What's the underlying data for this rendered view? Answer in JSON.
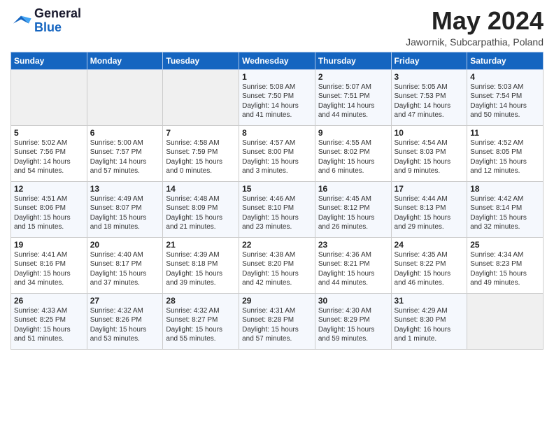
{
  "header": {
    "logo_general": "General",
    "logo_blue": "Blue",
    "month_title": "May 2024",
    "subtitle": "Jawornik, Subcarpathia, Poland"
  },
  "weekdays": [
    "Sunday",
    "Monday",
    "Tuesday",
    "Wednesday",
    "Thursday",
    "Friday",
    "Saturday"
  ],
  "weeks": [
    [
      {
        "day": "",
        "info": ""
      },
      {
        "day": "",
        "info": ""
      },
      {
        "day": "",
        "info": ""
      },
      {
        "day": "1",
        "info": "Sunrise: 5:08 AM\nSunset: 7:50 PM\nDaylight: 14 hours\nand 41 minutes."
      },
      {
        "day": "2",
        "info": "Sunrise: 5:07 AM\nSunset: 7:51 PM\nDaylight: 14 hours\nand 44 minutes."
      },
      {
        "day": "3",
        "info": "Sunrise: 5:05 AM\nSunset: 7:53 PM\nDaylight: 14 hours\nand 47 minutes."
      },
      {
        "day": "4",
        "info": "Sunrise: 5:03 AM\nSunset: 7:54 PM\nDaylight: 14 hours\nand 50 minutes."
      }
    ],
    [
      {
        "day": "5",
        "info": "Sunrise: 5:02 AM\nSunset: 7:56 PM\nDaylight: 14 hours\nand 54 minutes."
      },
      {
        "day": "6",
        "info": "Sunrise: 5:00 AM\nSunset: 7:57 PM\nDaylight: 14 hours\nand 57 minutes."
      },
      {
        "day": "7",
        "info": "Sunrise: 4:58 AM\nSunset: 7:59 PM\nDaylight: 15 hours\nand 0 minutes."
      },
      {
        "day": "8",
        "info": "Sunrise: 4:57 AM\nSunset: 8:00 PM\nDaylight: 15 hours\nand 3 minutes."
      },
      {
        "day": "9",
        "info": "Sunrise: 4:55 AM\nSunset: 8:02 PM\nDaylight: 15 hours\nand 6 minutes."
      },
      {
        "day": "10",
        "info": "Sunrise: 4:54 AM\nSunset: 8:03 PM\nDaylight: 15 hours\nand 9 minutes."
      },
      {
        "day": "11",
        "info": "Sunrise: 4:52 AM\nSunset: 8:05 PM\nDaylight: 15 hours\nand 12 minutes."
      }
    ],
    [
      {
        "day": "12",
        "info": "Sunrise: 4:51 AM\nSunset: 8:06 PM\nDaylight: 15 hours\nand 15 minutes."
      },
      {
        "day": "13",
        "info": "Sunrise: 4:49 AM\nSunset: 8:07 PM\nDaylight: 15 hours\nand 18 minutes."
      },
      {
        "day": "14",
        "info": "Sunrise: 4:48 AM\nSunset: 8:09 PM\nDaylight: 15 hours\nand 21 minutes."
      },
      {
        "day": "15",
        "info": "Sunrise: 4:46 AM\nSunset: 8:10 PM\nDaylight: 15 hours\nand 23 minutes."
      },
      {
        "day": "16",
        "info": "Sunrise: 4:45 AM\nSunset: 8:12 PM\nDaylight: 15 hours\nand 26 minutes."
      },
      {
        "day": "17",
        "info": "Sunrise: 4:44 AM\nSunset: 8:13 PM\nDaylight: 15 hours\nand 29 minutes."
      },
      {
        "day": "18",
        "info": "Sunrise: 4:42 AM\nSunset: 8:14 PM\nDaylight: 15 hours\nand 32 minutes."
      }
    ],
    [
      {
        "day": "19",
        "info": "Sunrise: 4:41 AM\nSunset: 8:16 PM\nDaylight: 15 hours\nand 34 minutes."
      },
      {
        "day": "20",
        "info": "Sunrise: 4:40 AM\nSunset: 8:17 PM\nDaylight: 15 hours\nand 37 minutes."
      },
      {
        "day": "21",
        "info": "Sunrise: 4:39 AM\nSunset: 8:18 PM\nDaylight: 15 hours\nand 39 minutes."
      },
      {
        "day": "22",
        "info": "Sunrise: 4:38 AM\nSunset: 8:20 PM\nDaylight: 15 hours\nand 42 minutes."
      },
      {
        "day": "23",
        "info": "Sunrise: 4:36 AM\nSunset: 8:21 PM\nDaylight: 15 hours\nand 44 minutes."
      },
      {
        "day": "24",
        "info": "Sunrise: 4:35 AM\nSunset: 8:22 PM\nDaylight: 15 hours\nand 46 minutes."
      },
      {
        "day": "25",
        "info": "Sunrise: 4:34 AM\nSunset: 8:23 PM\nDaylight: 15 hours\nand 49 minutes."
      }
    ],
    [
      {
        "day": "26",
        "info": "Sunrise: 4:33 AM\nSunset: 8:25 PM\nDaylight: 15 hours\nand 51 minutes."
      },
      {
        "day": "27",
        "info": "Sunrise: 4:32 AM\nSunset: 8:26 PM\nDaylight: 15 hours\nand 53 minutes."
      },
      {
        "day": "28",
        "info": "Sunrise: 4:32 AM\nSunset: 8:27 PM\nDaylight: 15 hours\nand 55 minutes."
      },
      {
        "day": "29",
        "info": "Sunrise: 4:31 AM\nSunset: 8:28 PM\nDaylight: 15 hours\nand 57 minutes."
      },
      {
        "day": "30",
        "info": "Sunrise: 4:30 AM\nSunset: 8:29 PM\nDaylight: 15 hours\nand 59 minutes."
      },
      {
        "day": "31",
        "info": "Sunrise: 4:29 AM\nSunset: 8:30 PM\nDaylight: 16 hours\nand 1 minute."
      },
      {
        "day": "",
        "info": ""
      }
    ]
  ]
}
